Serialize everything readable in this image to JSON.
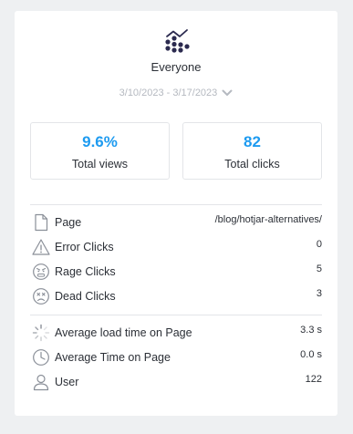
{
  "segment": {
    "icon": "segment-chart-icon",
    "name": "Everyone",
    "date_range": "3/10/2023 - 3/17/2023",
    "date_chevron_icon": "chevron-down-icon"
  },
  "stats": {
    "views": {
      "value": "9.6%",
      "label": "Total views"
    },
    "clicks": {
      "value": "82",
      "label": "Total clicks"
    }
  },
  "details": [
    {
      "icon": "page-icon",
      "label": "Page",
      "value": "/blog/hotjar-alternatives/"
    },
    {
      "icon": "warning-icon",
      "label": "Error Clicks",
      "value": "0"
    },
    {
      "icon": "angry-face-icon",
      "label": "Rage Clicks",
      "value": "5"
    },
    {
      "icon": "sad-face-icon",
      "label": "Dead Clicks",
      "value": "3"
    }
  ],
  "metrics": [
    {
      "icon": "loading-spinner-icon",
      "label": "Average load time on Page",
      "value": "3.3 s"
    },
    {
      "icon": "clock-icon",
      "label": "Average Time on Page",
      "value": "0.0 s"
    },
    {
      "icon": "user-icon",
      "label": "User",
      "value": "122"
    }
  ],
  "colors": {
    "accent": "#1e9bf0",
    "icon": "#2b2a4f",
    "muted": "#b5b9c0"
  }
}
